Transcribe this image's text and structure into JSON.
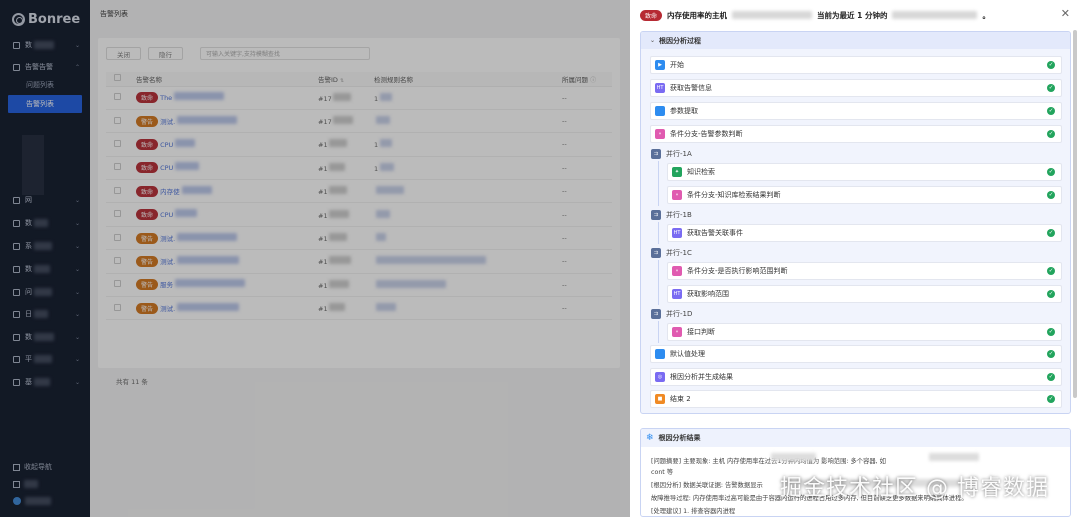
{
  "sidebar": {
    "logo": "Bonree",
    "items": [
      {
        "label": "数"
      },
      {
        "label": "告警告警"
      },
      {
        "label": "问题列表"
      },
      {
        "label": "告警列表"
      },
      {
        "label": "网"
      },
      {
        "label": "数"
      },
      {
        "label": "系"
      },
      {
        "label": "数"
      },
      {
        "label": "问"
      },
      {
        "label": "日"
      },
      {
        "label": "数"
      },
      {
        "label": "平"
      },
      {
        "label": "基"
      }
    ],
    "footer": {
      "collapse_label": "收起导航"
    }
  },
  "main": {
    "title": "告警列表",
    "toolbar": {
      "btn1": "关闭",
      "btn2": "隐行",
      "search_placeholder": "可输入关键字,支持模糊查找"
    },
    "columns": [
      "告警名称",
      "告警ID",
      "检测规则名称",
      "所属问题"
    ],
    "rows": [
      {
        "severity": "致命",
        "sev_color": "#b62a33",
        "name": "The",
        "id": "#17",
        "rule": "1",
        "problem": "--"
      },
      {
        "severity": "警告",
        "sev_color": "#d2741b",
        "name": "测试.",
        "id": "#17",
        "rule": "",
        "problem": "--"
      },
      {
        "severity": "致命",
        "sev_color": "#b62a33",
        "name": "CPU",
        "id": "#1",
        "rule": "1",
        "problem": "--"
      },
      {
        "severity": "致命",
        "sev_color": "#b62a33",
        "name": "CPU",
        "id": "#1",
        "rule": "1",
        "problem": "--"
      },
      {
        "severity": "致命",
        "sev_color": "#b62a33",
        "name": "内存使",
        "id": "#1",
        "rule": "",
        "problem": "--"
      },
      {
        "severity": "致命",
        "sev_color": "#b62a33",
        "name": "CPU",
        "id": "#1",
        "rule": "",
        "problem": "--"
      },
      {
        "severity": "警告",
        "sev_color": "#d2741b",
        "name": "测试.",
        "id": "#1",
        "rule": "",
        "problem": "--"
      },
      {
        "severity": "警告",
        "sev_color": "#d2741b",
        "name": "测试.",
        "id": "#1",
        "rule": "",
        "problem": "--"
      },
      {
        "severity": "警告",
        "sev_color": "#d2741b",
        "name": "服务",
        "id": "#1",
        "rule": "",
        "problem": "--"
      },
      {
        "severity": "警告",
        "sev_color": "#d2741b",
        "name": "测试.",
        "id": "#1",
        "rule": "",
        "problem": "--"
      }
    ],
    "count": "共有 11 条"
  },
  "drawer": {
    "severity": "致命",
    "title_prefix": "内存使用率的主机",
    "title_mid": "当前为最近 1 分钟的",
    "title_suffix": "。",
    "rca_title": "根因分析过程",
    "steps": [
      {
        "label": "开始",
        "icon": "play-icon",
        "color": "#2d8cf0"
      },
      {
        "label": "获取告警信息",
        "icon": "http-icon",
        "color": "#7a6bf2"
      },
      {
        "label": "参数提取",
        "icon": "code-icon",
        "color": "#2d8cf0"
      },
      {
        "label": "条件分支-告警参数判断",
        "icon": "branch-icon",
        "color": "#e05bb0"
      },
      {
        "label": "并行-1A",
        "icon": "parallel-icon",
        "color": "#5a6f99"
      },
      {
        "label": "知识检索",
        "icon": "knowledge-icon",
        "color": "#22a45d"
      },
      {
        "label": "条件分支-知识库检索结果判断",
        "icon": "branch-icon",
        "color": "#e05bb0"
      },
      {
        "label": "并行-1B",
        "icon": "parallel-icon",
        "color": "#5a6f99"
      },
      {
        "label": "获取告警关联事件",
        "icon": "http-icon",
        "color": "#7a6bf2"
      },
      {
        "label": "并行-1C",
        "icon": "parallel-icon",
        "color": "#5a6f99"
      },
      {
        "label": "条件分支-是否执行影响范围判断",
        "icon": "branch-icon",
        "color": "#e05bb0"
      },
      {
        "label": "获取影响范围",
        "icon": "http-icon",
        "color": "#7a6bf2"
      },
      {
        "label": "并行-1D",
        "icon": "parallel-icon",
        "color": "#5a6f99"
      },
      {
        "label": "接口判断",
        "icon": "branch-icon",
        "color": "#e05bb0"
      },
      {
        "label": "默认值处理",
        "icon": "code-icon",
        "color": "#2d8cf0"
      },
      {
        "label": "根因分析并生成结果",
        "icon": "ai-icon",
        "color": "#7a6bf2"
      },
      {
        "label": "结束 2",
        "icon": "end-icon",
        "color": "#f08a24"
      }
    ],
    "result_title": "根因分析结果",
    "result_lines": [
      "[问题摘要] 主要现象: 主机                    内存使用率在过去1分钟内均值为                    影响范围: 多个容器, 如",
      "cont                                                                            等",
      "[根因分析] 数据关联证据: 告警数据显示                                                         ",
      "故障推导过程: 内存使用率过高可能是由于容器内运行的进程占用过多内存, 但目前缺乏更多数据来明确具体进程。",
      "[处理建议] 1. 排查容器内进程"
    ]
  },
  "watermark": "掘金技术社区 @ 博睿数据"
}
